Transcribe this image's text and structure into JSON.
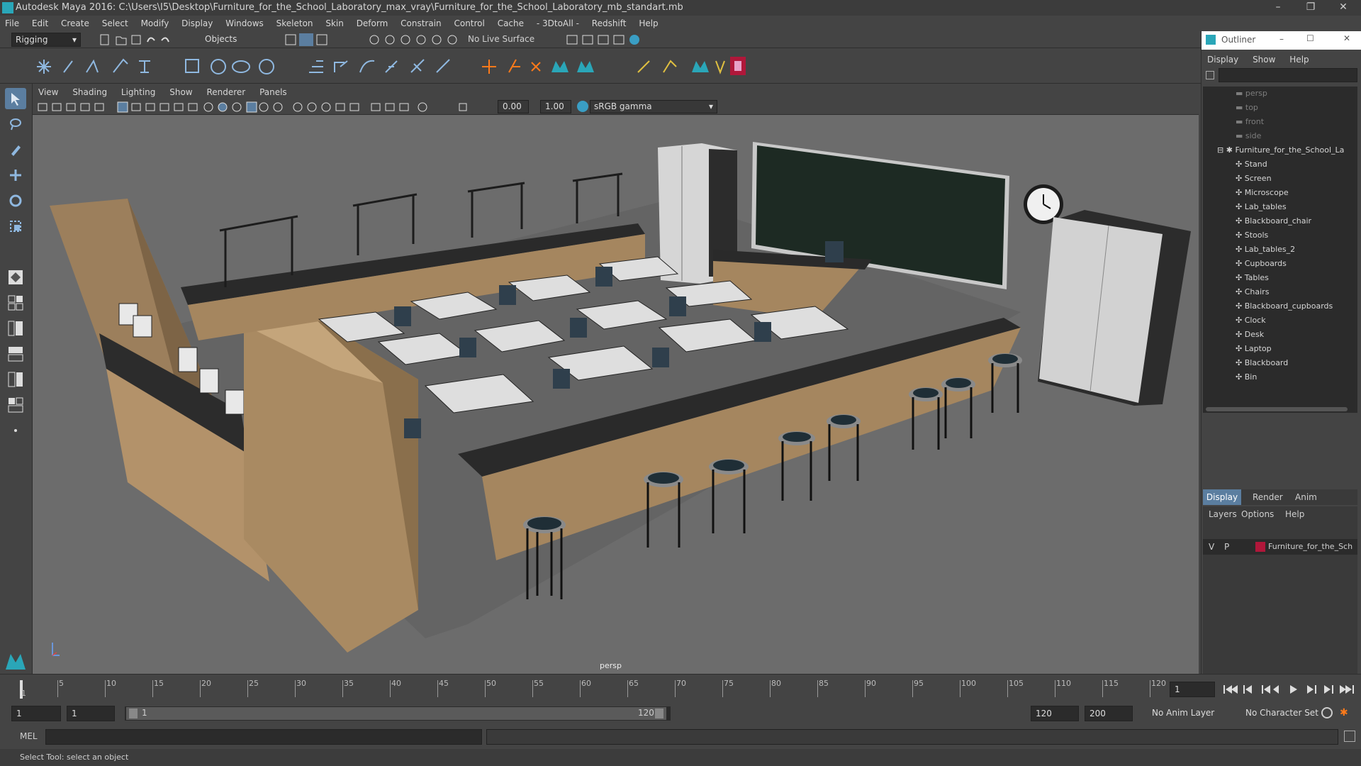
{
  "app": {
    "title": "Autodesk Maya 2016: C:\\Users\\I5\\Desktop\\Furniture_for_the_School_Laboratory_max_vray\\Furniture_for_the_School_Laboratory_mb_standart.mb"
  },
  "menubar": [
    "File",
    "Edit",
    "Create",
    "Select",
    "Modify",
    "Display",
    "Windows",
    "Skeleton",
    "Skin",
    "Deform",
    "Constrain",
    "Control",
    "Cache",
    "- 3DtoAll -",
    "Redshift",
    "Help"
  ],
  "statusline": {
    "menuset": "Rigging",
    "selection_mode": "Objects",
    "live_surface": "No Live Surface"
  },
  "panel": {
    "menus": [
      "View",
      "Shading",
      "Lighting",
      "Show",
      "Renderer",
      "Panels"
    ],
    "near_value": "0.00",
    "far_value": "1.00",
    "color_space": "sRGB gamma",
    "camera_label": "persp"
  },
  "outliner": {
    "title": "Outliner",
    "menus": [
      "Display",
      "Show",
      "Help"
    ],
    "cameras": [
      "persp",
      "top",
      "front",
      "side"
    ],
    "root": "Furniture_for_the_School_La",
    "children": [
      "Stand",
      "Screen",
      "Microscope",
      "Lab_tables",
      "Blackboard_chair",
      "Stools",
      "Lab_tables_2",
      "Cupboards",
      "Tables",
      "Chairs",
      "Blackboard_cupboards",
      "Clock",
      "Desk",
      "Laptop",
      "Blackboard",
      "Bin"
    ]
  },
  "layers": {
    "tabs": [
      "Display",
      "Render",
      "Anim"
    ],
    "menus": [
      "Layers",
      "Options",
      "Help"
    ],
    "layer": {
      "v": "V",
      "p": "P",
      "name": "Furniture_for_the_Sch",
      "color": "#b0173a"
    }
  },
  "timeline": {
    "ticks": [
      "1",
      "5",
      "10",
      "15",
      "20",
      "25",
      "30",
      "35",
      "40",
      "45",
      "50",
      "55",
      "60",
      "65",
      "70",
      "75",
      "80",
      "85",
      "90",
      "95",
      "100",
      "105",
      "110",
      "115",
      "120"
    ],
    "current_frame": "1"
  },
  "range": {
    "start": "1",
    "current": "1",
    "slider_start": "1",
    "slider_end": "120",
    "end": "120",
    "max_end": "200",
    "anim_layer": "No Anim Layer",
    "char_set": "No Character Set"
  },
  "command": {
    "lang": "MEL"
  },
  "helpline": {
    "text": "Select Tool: select an object"
  },
  "colors": {
    "accent": "#5b7ea0",
    "viewport_bg": "#6c6c6c"
  }
}
